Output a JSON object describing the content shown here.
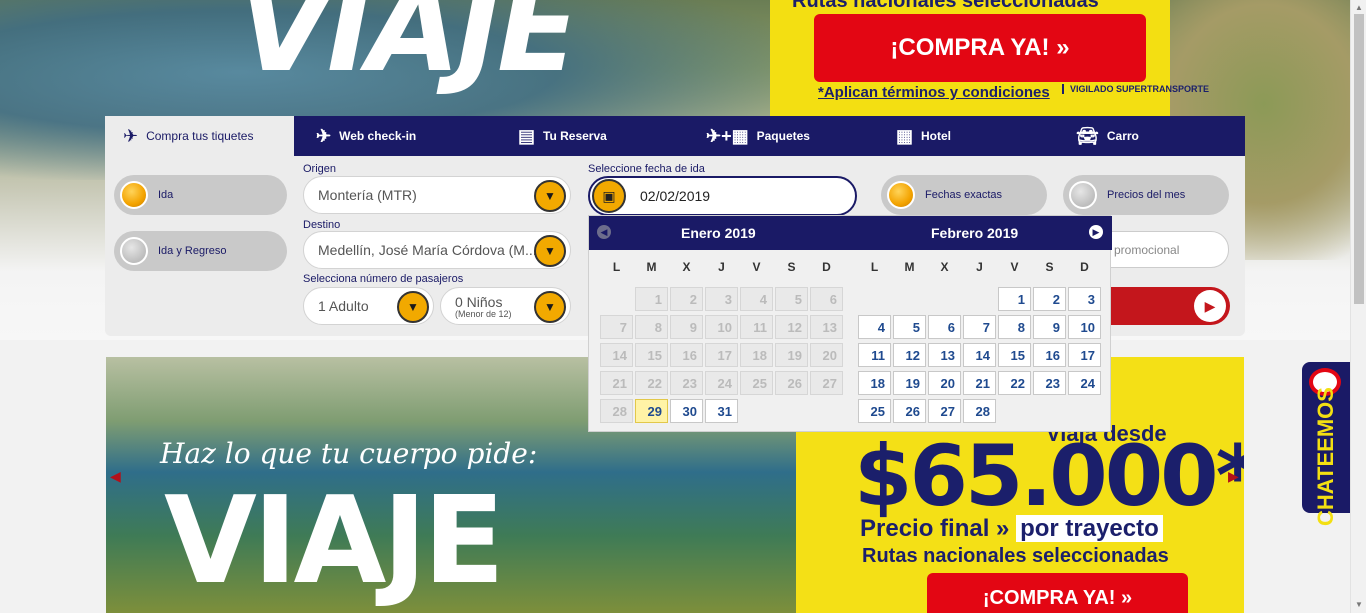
{
  "hero_top": {
    "headline": "VIAJE",
    "routes_text": "Rutas nacionales seleccionadas",
    "buy_label": "¡COMPRA YA!  »",
    "terms": "*Aplican términos y condiciones",
    "vigilado": "VIGILADO SUPERTRANSPORTE"
  },
  "tabs": [
    {
      "label": "Compra tus tiquetes",
      "icon": "plane-cloud-icon"
    },
    {
      "label": "Web check-in",
      "icon": "plane-cloud-icon"
    },
    {
      "label": "Tu Reserva",
      "icon": "ticket-icon"
    },
    {
      "label": "Paquetes",
      "icon": "plane-hotel-icon"
    },
    {
      "label": "Hotel",
      "icon": "building-icon"
    },
    {
      "label": "Carro",
      "icon": "car-icon"
    }
  ],
  "trip_type": {
    "one_way": "Ida",
    "round_trip": "Ida y Regreso"
  },
  "origin": {
    "label": "Origen",
    "value": "Montería (MTR)"
  },
  "destination": {
    "label": "Destino",
    "value": "Medellín, José María Córdova (M..."
  },
  "passengers": {
    "label": "Selecciona número de pasajeros",
    "adults": "1 Adulto",
    "children": "0 Niños",
    "children_note": "(Menor de 12)"
  },
  "date": {
    "label": "Seleccione fecha de ida",
    "value": "02/02/2019"
  },
  "flex_options": {
    "exact": "Fechas exactas",
    "month_prices": "Precios del mes"
  },
  "promo_code": {
    "placeholder_visible": "o promocional"
  },
  "calendar": {
    "weekdays": [
      "L",
      "M",
      "X",
      "J",
      "V",
      "S",
      "D"
    ],
    "months": [
      {
        "name": "Enero 2019",
        "offset": 1,
        "days": 31,
        "enabled_from": 29,
        "selected": 29
      },
      {
        "name": "Febrero 2019",
        "offset": 4,
        "days": 28,
        "enabled_from": 1,
        "selected": null
      }
    ]
  },
  "promo_banner": {
    "slogan": "Haz lo que tu cuerpo pide:",
    "headline": "VIAJE",
    "desde": "Viaja desde",
    "price": "$65.000*",
    "final_a": "Precio final » ",
    "final_b": "por trayecto",
    "routes": "Rutas nacionales seleccionadas",
    "buy_label": "¡COMPRA YA!  »"
  },
  "chat": {
    "label": "CHATEEMOS"
  },
  "colors": {
    "navy": "#1a1a66",
    "accent_yellow": "#f3df12",
    "accent_red": "#e30613",
    "orange": "#f2a900"
  }
}
